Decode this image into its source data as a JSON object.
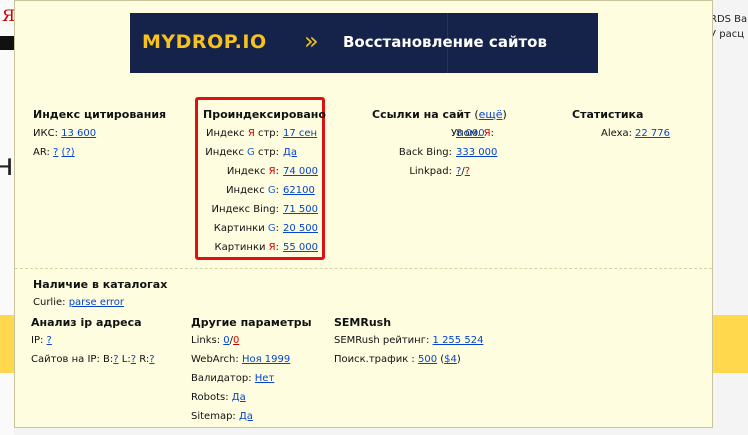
{
  "bg": {
    "logo_text": "Я",
    "right_line1": "RDS Ba",
    "right_line2": "У расц",
    "big_letter": "н"
  },
  "banner": {
    "brand": "MYDROP.IO",
    "chevron": "»",
    "text": "Восстановление сайтов"
  },
  "citation": {
    "title": "Индекс цитирования",
    "iks_label": "ИКС:",
    "iks_value": "13 600",
    "ar_label": "AR:",
    "ar_value": "?",
    "ar_paren": "(?)"
  },
  "indexed": {
    "title": "Проиндексировано",
    "rows": [
      {
        "label_pre": "Индекс ",
        "engine": "Я",
        "label_post": " стр:",
        "value": "17 сен"
      },
      {
        "label_pre": "Индекс ",
        "engine": "G",
        "label_post": " стр:",
        "value": "Да"
      },
      {
        "label_pre": "Индекс ",
        "engine": "Я",
        "label_post": ":",
        "value": "74 000"
      },
      {
        "label_pre": "Индекс ",
        "engine": "G",
        "label_post": ":",
        "value": "62100"
      },
      {
        "label_pre": "Индекс Bing",
        "engine": "",
        "label_post": ":",
        "value": "71 500"
      },
      {
        "label_pre": "Картинки ",
        "engine": "G",
        "label_post": ":",
        "value": "20 500"
      },
      {
        "label_pre": "Картинки ",
        "engine": "Я",
        "label_post": ":",
        "value": "55 000"
      }
    ]
  },
  "links": {
    "title": "Ссылки на сайт",
    "more_open": "(",
    "more": "ещё",
    "more_close": ")",
    "mentions_label": "Упом. ",
    "mentions_engine": "Я",
    "mentions_colon": ":",
    "mentions_value": "8 000",
    "backbing_label": "Back Bing:",
    "backbing_value": "333 000",
    "linkpad_label": "Linkpad:",
    "linkpad_q1": "?",
    "linkpad_slash": "/",
    "linkpad_q2": "?"
  },
  "stats": {
    "title": "Статистика",
    "alexa_label": "Alexa:",
    "alexa_value": "22 776"
  },
  "catalogs": {
    "title": "Наличие в каталогах",
    "curlie_label": "Curlie:",
    "curlie_value": "parse error"
  },
  "ip": {
    "title": "Анализ ip адреса",
    "ip_label": "IP:",
    "ip_value": "?",
    "sites_label": "Сайтов на IP:",
    "b_label": "B:",
    "b_value": "?",
    "l_label": "L:",
    "l_value": "?",
    "r_label": "R:",
    "r_value": "?"
  },
  "other": {
    "title": "Другие параметры",
    "links_label": "Links:",
    "links_v1": "0",
    "links_slash": "/",
    "links_v2": "0",
    "webarch_label": "WebArch:",
    "webarch_value": "Ноя 1999",
    "validator_label": "Валидатор:",
    "validator_value": "Нет",
    "robots_label": "Robots:",
    "robots_value": "Да",
    "sitemap_label": "Sitemap:",
    "sitemap_value": "Да"
  },
  "semrush": {
    "title": "SEMRush",
    "rating_label": "SEMRush рейтинг:",
    "rating_value": "1 255 524",
    "traffic_label": "Поиск.трафик :",
    "traffic_value": "500",
    "traffic_paren_open": " (",
    "traffic_cost": "$4",
    "traffic_paren_close": ")"
  },
  "colors": {
    "yandex_red": "#d40000",
    "google_blue": "#2060c8",
    "link": "#0645c8",
    "highlight_box": "#e01010",
    "popup_bg": "#fffde0"
  }
}
